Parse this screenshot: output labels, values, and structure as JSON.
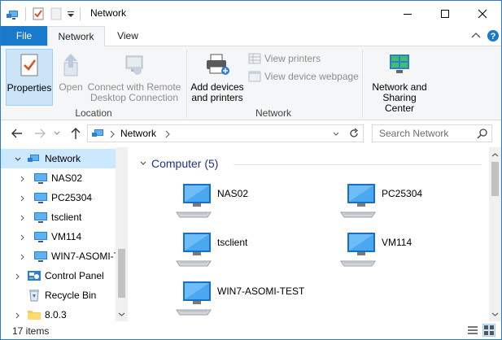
{
  "window": {
    "title": "Network",
    "accent": "#1979ca"
  },
  "tabs": {
    "file": "File",
    "network": "Network",
    "view": "View"
  },
  "ribbon": {
    "location": {
      "properties": "Properties",
      "open": "Open",
      "connect_line1": "Connect with Remote",
      "connect_line2": "Desktop Connection",
      "group_label": "Location"
    },
    "network": {
      "add_line1": "Add devices",
      "add_line2": "and printers",
      "view_printers": "View printers",
      "view_device_webpage": "View device webpage",
      "group_label": "Network"
    },
    "sharing": {
      "line1": "Network and",
      "line2": "Sharing Center"
    }
  },
  "address": {
    "crumb": "Network",
    "search_placeholder": "Search Network"
  },
  "nav_pane": {
    "items": [
      {
        "label": "Network",
        "icon": "network-icon",
        "selected": true
      },
      {
        "label": "NAS02",
        "icon": "computer-icon"
      },
      {
        "label": "PC25304",
        "icon": "computer-icon"
      },
      {
        "label": "tsclient",
        "icon": "computer-icon"
      },
      {
        "label": "VM114",
        "icon": "computer-icon"
      },
      {
        "label": "WIN7-ASOMI-T",
        "icon": "computer-icon"
      },
      {
        "label": "Control Panel",
        "icon": "control-panel-icon"
      },
      {
        "label": "Recycle Bin",
        "icon": "recycle-bin-icon"
      },
      {
        "label": "8.0.3",
        "icon": "folder-icon"
      }
    ]
  },
  "content": {
    "group_header": "Computer (5)",
    "items": [
      {
        "label": "NAS02"
      },
      {
        "label": "PC25304"
      },
      {
        "label": "tsclient"
      },
      {
        "label": "VM114"
      },
      {
        "label": "WIN7-ASOMI-TEST"
      }
    ]
  },
  "status": {
    "count": "17 items"
  }
}
